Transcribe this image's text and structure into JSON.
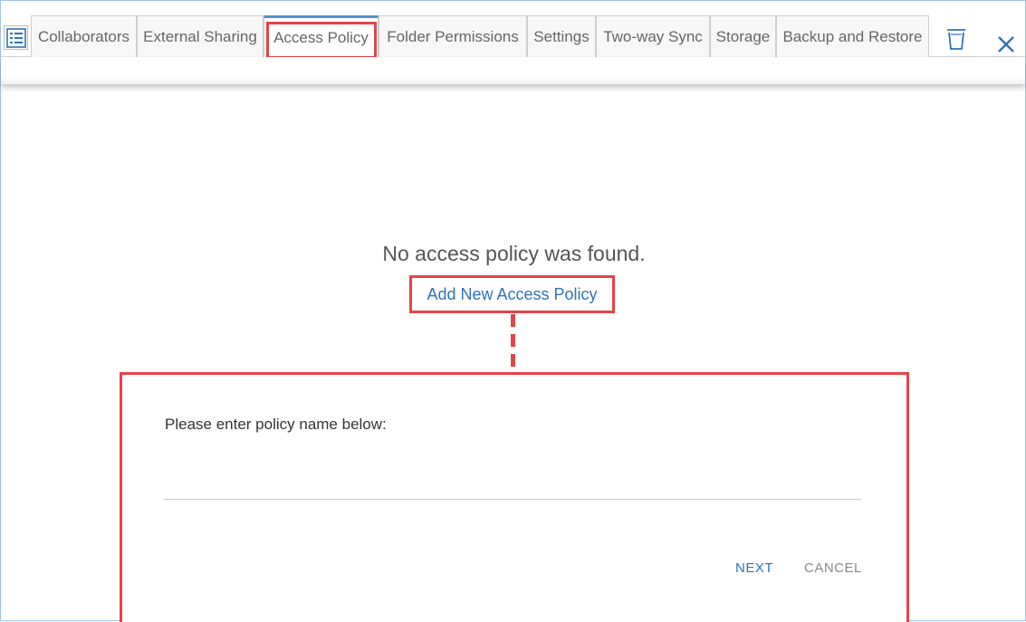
{
  "tabs": [
    {
      "label": "Collaborators"
    },
    {
      "label": "External Sharing"
    },
    {
      "label": "Access Policy",
      "active": true
    },
    {
      "label": "Folder Permissions"
    },
    {
      "label": "Settings"
    },
    {
      "label": "Two-way Sync"
    },
    {
      "label": "Storage"
    },
    {
      "label": "Backup and Restore"
    }
  ],
  "icons": {
    "list": "list-icon",
    "trash": "trash-icon",
    "close": "close-icon"
  },
  "content": {
    "empty_message": "No access policy was found.",
    "add_link": "Add New Access Policy"
  },
  "dialog": {
    "prompt": "Please enter policy name below:",
    "input_value": "",
    "input_placeholder": "",
    "next_label": "NEXT",
    "cancel_label": "CANCEL"
  },
  "colors": {
    "accent": "#2f73b6",
    "highlight": "#e5434a",
    "active_tab_top": "#5b8fd0"
  }
}
